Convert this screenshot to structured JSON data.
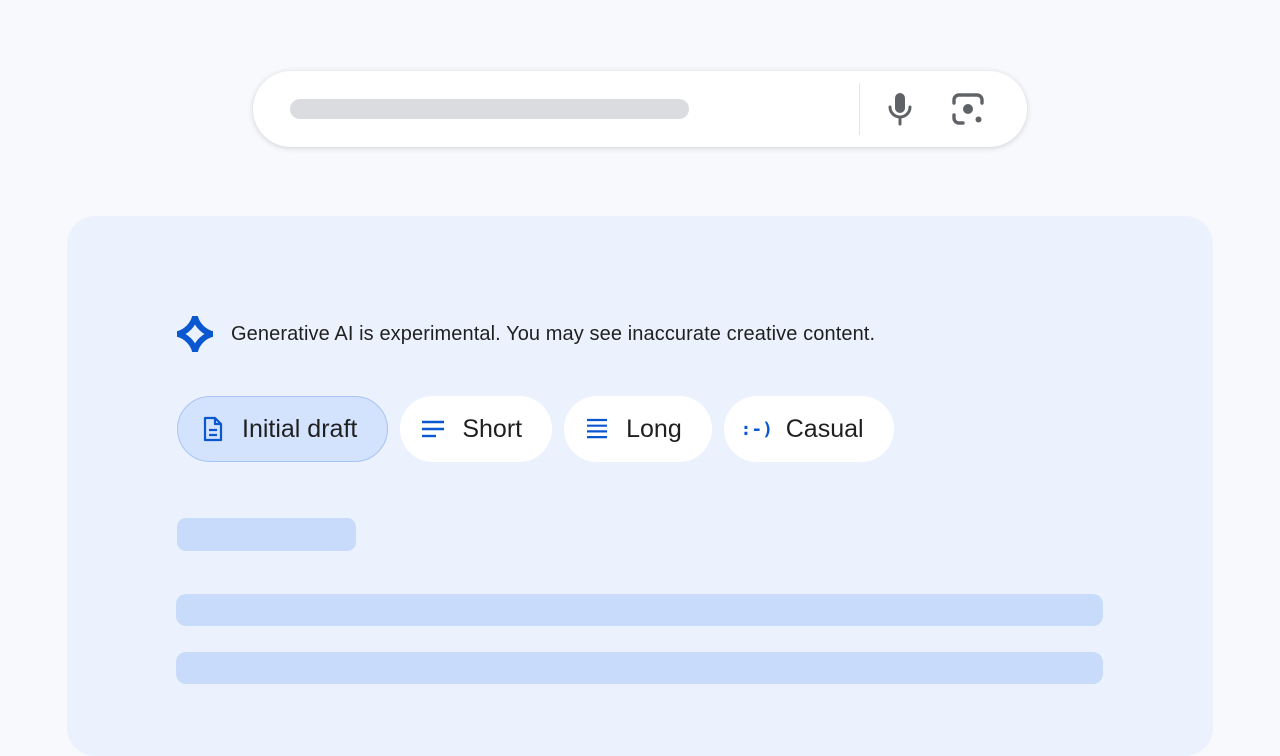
{
  "search": {
    "placeholder_bar": "",
    "mic_icon": "microphone-icon",
    "lens_icon": "camera-lens-icon"
  },
  "panel": {
    "notice_icon": "gemini-sparkle-icon",
    "notice_text": "Generative AI is experimental. You may see inaccurate creative content.",
    "chips": [
      {
        "label": "Initial draft",
        "icon": "document-icon",
        "selected": true
      },
      {
        "label": "Short",
        "icon": "short-lines-icon",
        "selected": false
      },
      {
        "label": "Long",
        "icon": "long-lines-icon",
        "selected": false
      },
      {
        "label": "Casual",
        "icon": "casual-emoticon-icon",
        "glyph": ":-)",
        "selected": false
      }
    ]
  },
  "colors": {
    "accent": "#0b57d0",
    "page_bg": "#f7f9fc",
    "panel_bg": "#ecf2fd",
    "chip_selected_bg": "#d3e2fd",
    "skeleton": "#c9dbfb"
  }
}
